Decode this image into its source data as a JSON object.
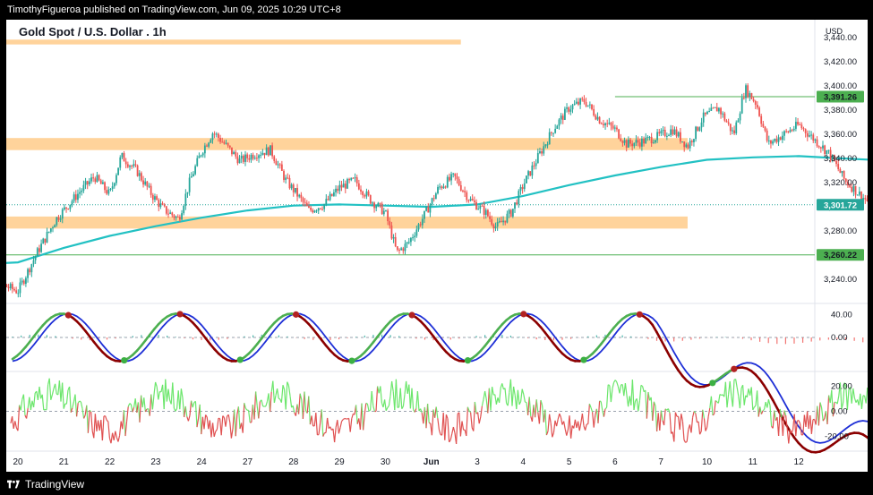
{
  "header": {
    "publish_text": "TimothyFigueroa published on TradingView.com, Jun 09, 2025 10:29 UTC+8"
  },
  "footer": {
    "brand": "TradingView",
    "logo_icon": "tradingview-logo-icon"
  },
  "chart": {
    "title": "Gold Spot / U.S. Dollar . 1h",
    "currency": "USD",
    "colors": {
      "up": "#26a69a",
      "down": "#ef5350",
      "ma": "#22c1c3",
      "zone": "#ffd39b",
      "hline": "#4caf50",
      "fast": "#4caf50",
      "slow": "#1e2fd6",
      "dark": "#8b0000",
      "osc_up": "#6be66b",
      "osc_down": "#e05050"
    }
  },
  "chart_data": [
    {
      "type": "candlestick",
      "title": "Gold Spot / U.S. Dollar . 1h",
      "ylabel": "USD",
      "ylim": [
        3220,
        3455
      ],
      "y_ticks": [
        "3,240.00",
        "3,260.00",
        "3,280.00",
        "3,300.00",
        "3,320.00",
        "3,340.00",
        "3,360.00",
        "3,380.00",
        "3,400.00",
        "3,420.00",
        "3,440.00"
      ],
      "x_ticks": [
        "20",
        "21",
        "22",
        "23",
        "24",
        "27",
        "28",
        "29",
        "30",
        "Jun",
        "3",
        "4",
        "5",
        "6",
        "7",
        "10",
        "11",
        "12"
      ],
      "price_labels": [
        {
          "text": "3,391.26",
          "value": 3391.26,
          "style": "green"
        },
        {
          "text": "3,301.72",
          "value": 3301.72,
          "style": "teal"
        },
        {
          "text": "3,260.22",
          "value": 3260.22,
          "style": "green"
        }
      ],
      "zones": [
        {
          "low": 3434.5,
          "high": 3438.5,
          "x_end_label": "3"
        },
        {
          "low": 3347,
          "high": 3357,
          "x_end_label": "7"
        },
        {
          "low": 3282,
          "high": 3292,
          "x_end_label": "7"
        }
      ],
      "horizontal_lines": [
        3391.26,
        3260.22
      ],
      "close_path": [
        [
          "19 00:00",
          3248
        ],
        [
          "19 12:00",
          3238
        ],
        [
          "20 00:00",
          3230
        ],
        [
          "20 10:00",
          3262
        ],
        [
          "20 20:00",
          3290
        ],
        [
          "21 08:00",
          3312
        ],
        [
          "21 16:00",
          3325
        ],
        [
          "22 00:00",
          3310
        ],
        [
          "22 06:00",
          3342
        ],
        [
          "22 14:00",
          3330
        ],
        [
          "22 22:00",
          3310
        ],
        [
          "23 04:00",
          3298
        ],
        [
          "23 12:00",
          3290
        ],
        [
          "23 18:00",
          3322
        ],
        [
          "24 00:00",
          3346
        ],
        [
          "24 06:00",
          3362
        ],
        [
          "24 12:00",
          3352
        ],
        [
          "24 20:00",
          3338
        ],
        [
          "25 04:00",
          3344
        ],
        [
          "25 12:00",
          3347
        ],
        [
          "25 20:00",
          3322
        ],
        [
          "26 02:00",
          3310
        ],
        [
          "26 08:00",
          3297
        ],
        [
          "26 16:00",
          3302
        ],
        [
          "27 00:00",
          3316
        ],
        [
          "27 08:00",
          3322
        ],
        [
          "27 16:00",
          3306
        ],
        [
          "28 00:00",
          3295
        ],
        [
          "28 06:00",
          3262
        ],
        [
          "28 12:00",
          3270
        ],
        [
          "28 20:00",
          3292
        ],
        [
          "29 04:00",
          3316
        ],
        [
          "29 12:00",
          3325
        ],
        [
          "29 20:00",
          3306
        ],
        [
          "30 04:00",
          3296
        ],
        [
          "30 10:00",
          3283
        ],
        [
          "30 18:00",
          3296
        ],
        [
          "31 00:00",
          3318
        ],
        [
          "31 08:00",
          3342
        ],
        [
          "31 16:00",
          3365
        ],
        [
          "32 00:00",
          3382
        ],
        [
          "32 08:00",
          3388
        ],
        [
          "32 16:00",
          3372
        ],
        [
          "33 00:00",
          3364
        ],
        [
          "33 06:00",
          3352
        ],
        [
          "33 14:00",
          3354
        ],
        [
          "33 22:00",
          3358
        ],
        [
          "34 06:00",
          3364
        ],
        [
          "34 14:00",
          3350
        ],
        [
          "34 22:00",
          3374
        ],
        [
          "35 06:00",
          3382
        ],
        [
          "35 14:00",
          3360
        ],
        [
          "35 20:00",
          3398
        ],
        [
          "36 02:00",
          3385
        ],
        [
          "36 08:00",
          3352
        ],
        [
          "36 16:00",
          3360
        ],
        [
          "37 00:00",
          3368
        ],
        [
          "37 08:00",
          3356
        ],
        [
          "37 16:00",
          3344
        ],
        [
          "38 00:00",
          3322
        ],
        [
          "38 08:00",
          3310
        ],
        [
          "38 14:00",
          3301.72
        ]
      ],
      "moving_average": [
        [
          "19 00:00",
          3252
        ],
        [
          "20 00:00",
          3254
        ],
        [
          "21 00:00",
          3266
        ],
        [
          "22 00:00",
          3276
        ],
        [
          "23 00:00",
          3284
        ],
        [
          "24 00:00",
          3291
        ],
        [
          "25 00:00",
          3297
        ],
        [
          "26 00:00",
          3301
        ],
        [
          "27 00:00",
          3302
        ],
        [
          "28 00:00",
          3301
        ],
        [
          "29 00:00",
          3300
        ],
        [
          "30 00:00",
          3302
        ],
        [
          "31 00:00",
          3309
        ],
        [
          "32 00:00",
          3318
        ],
        [
          "33 00:00",
          3326
        ],
        [
          "34 00:00",
          3333
        ],
        [
          "35 00:00",
          3339
        ],
        [
          "36 00:00",
          3341
        ],
        [
          "37 00:00",
          3342
        ],
        [
          "38 00:00",
          3340
        ],
        [
          "38 14:00",
          3339
        ]
      ]
    },
    {
      "type": "line",
      "title": "",
      "ylim": [
        -60,
        60
      ],
      "y_ticks": [
        "40.00",
        "0.00"
      ],
      "note": "trend oscillator with histogram and crossover dots"
    },
    {
      "type": "line",
      "title": "",
      "ylim": [
        -32,
        32
      ],
      "y_ticks": [
        "20.00",
        "0.00",
        "-20.00"
      ]
    }
  ]
}
